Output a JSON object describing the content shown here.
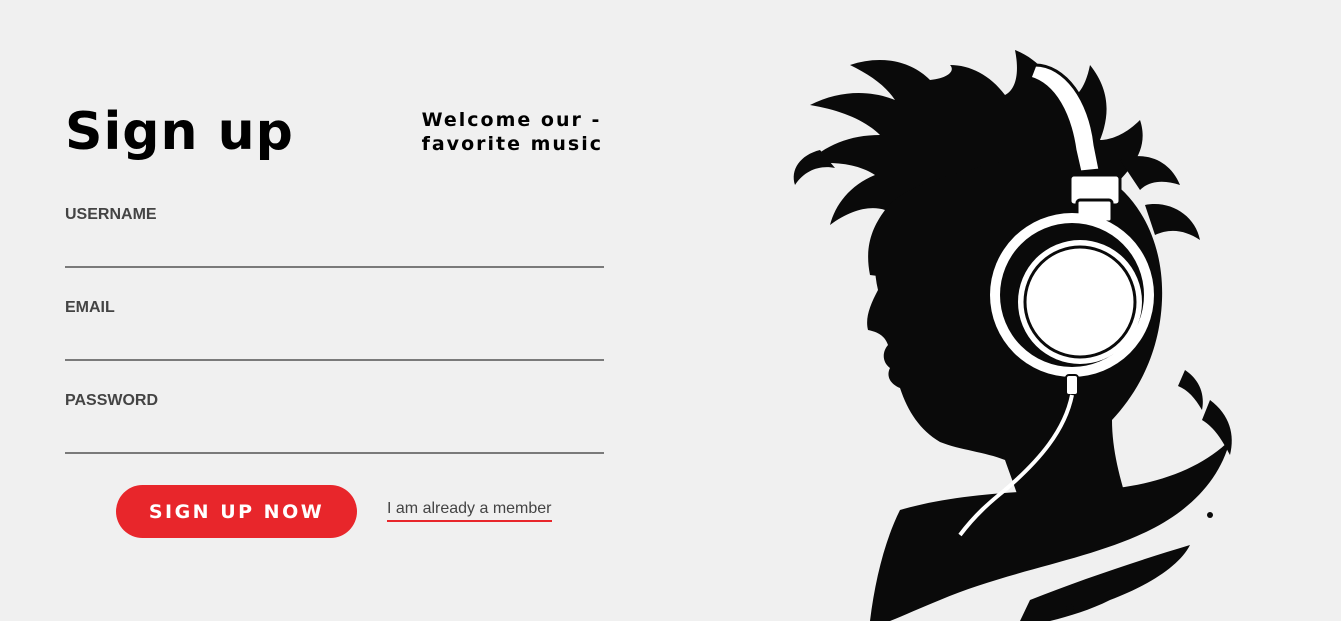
{
  "page": {
    "title": "Sign up",
    "welcome_line1": "Welcome our -",
    "welcome_line2": "favorite music"
  },
  "form": {
    "username_label": "USERNAME",
    "email_label": "EMAIL",
    "password_label": "PASSWORD",
    "username_value": "",
    "email_value": "",
    "password_value": "",
    "submit_label": "SIGN UP NOW",
    "member_link_label": "I am already a member"
  },
  "colors": {
    "background": "#f0f0f0",
    "accent": "#e8262b",
    "text": "#000000",
    "label": "#444444",
    "underline": "#7a7a7a"
  },
  "illustration": {
    "icon": "headphones-silhouette-icon"
  }
}
